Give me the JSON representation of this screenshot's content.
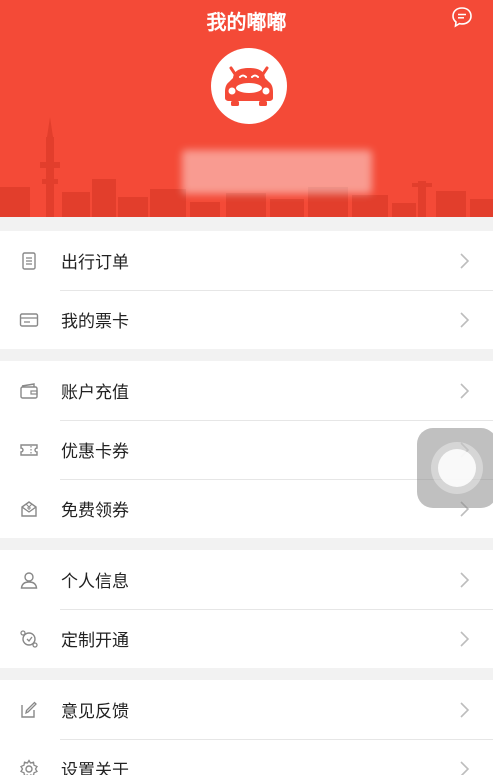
{
  "header": {
    "title": "我的嘟嘟",
    "background": "#f44a37"
  },
  "menu_groups": [
    [
      {
        "label": "出行订单",
        "icon": "order-list-icon"
      },
      {
        "label": "我的票卡",
        "icon": "ticket-card-icon"
      }
    ],
    [
      {
        "label": "账户充值",
        "icon": "wallet-icon"
      },
      {
        "label": "优惠卡券",
        "icon": "coupon-icon"
      },
      {
        "label": "免费领券",
        "icon": "yen-envelope-icon"
      }
    ],
    [
      {
        "label": "个人信息",
        "icon": "person-icon"
      },
      {
        "label": "定制开通",
        "icon": "custom-route-icon"
      }
    ],
    [
      {
        "label": "意见反馈",
        "icon": "edit-feedback-icon"
      },
      {
        "label": "设置关于",
        "icon": "gear-icon"
      }
    ]
  ],
  "colors": {
    "accent": "#f44a37",
    "text": "#222222",
    "icon": "#888888",
    "divider": "#e6e6e6"
  }
}
